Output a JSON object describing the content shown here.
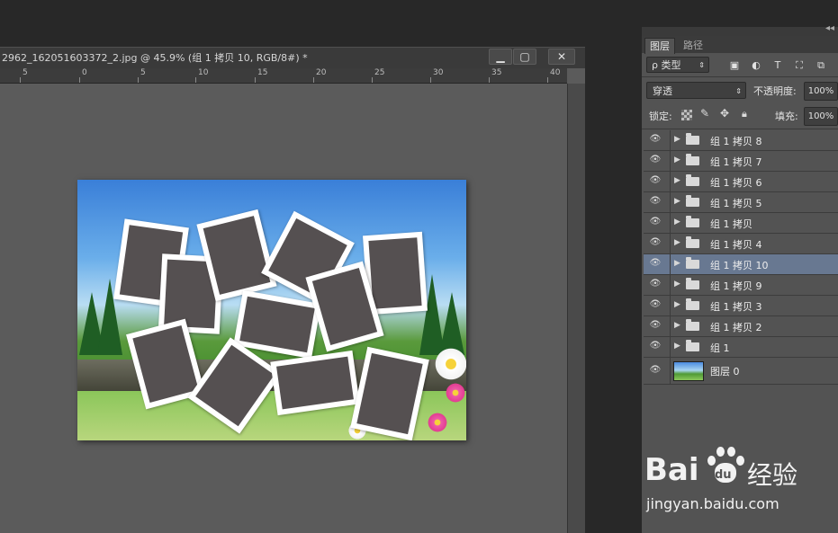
{
  "document": {
    "title": "2962_162051603372_2.jpg @ 45.9% (组 1 拷贝 10, RGB/8#) *",
    "minimize_label": "▁",
    "restore_label": "▢",
    "close_label": "✕",
    "ruler_ticks": [
      "5",
      "0",
      "5",
      "10",
      "15",
      "20",
      "25",
      "30",
      "35",
      "40"
    ]
  },
  "panel": {
    "tabs": [
      "图层",
      "路径"
    ],
    "filter_kind_label": "ρ 类型",
    "filter_icons": [
      "image-filter-icon",
      "adjustment-filter-icon",
      "type-filter-icon",
      "shape-filter-icon",
      "smart-object-filter-icon"
    ],
    "blend_mode": "穿透",
    "opacity_label": "不透明度:",
    "opacity_value": "100%",
    "lock_label": "锁定:",
    "fill_label": "填充:",
    "fill_value": "100%",
    "layers": [
      {
        "name": "组 1 拷贝 8",
        "type": "group",
        "selected": false
      },
      {
        "name": "组 1 拷贝 7",
        "type": "group",
        "selected": false
      },
      {
        "name": "组 1 拷贝 6",
        "type": "group",
        "selected": false
      },
      {
        "name": "组 1 拷贝 5",
        "type": "group",
        "selected": false
      },
      {
        "name": "组 1 拷贝",
        "type": "group",
        "selected": false
      },
      {
        "name": "组 1 拷贝 4",
        "type": "group",
        "selected": false
      },
      {
        "name": "组 1 拷贝 10",
        "type": "group",
        "selected": true
      },
      {
        "name": "组 1 拷贝 9",
        "type": "group",
        "selected": false
      },
      {
        "name": "组 1 拷贝 3",
        "type": "group",
        "selected": false
      },
      {
        "name": "组 1 拷贝 2",
        "type": "group",
        "selected": false
      },
      {
        "name": "组 1",
        "type": "group",
        "selected": false
      },
      {
        "name": "图层 0",
        "type": "image",
        "selected": false
      }
    ]
  },
  "watermark": {
    "brand": "Bai",
    "brand_suffix": "du",
    "product": "经验",
    "url": "jingyan.baidu.com"
  },
  "colors": {
    "selected_layer": "#687891",
    "panel_bg": "#535353",
    "workspace_bg": "#5b5b5b"
  }
}
